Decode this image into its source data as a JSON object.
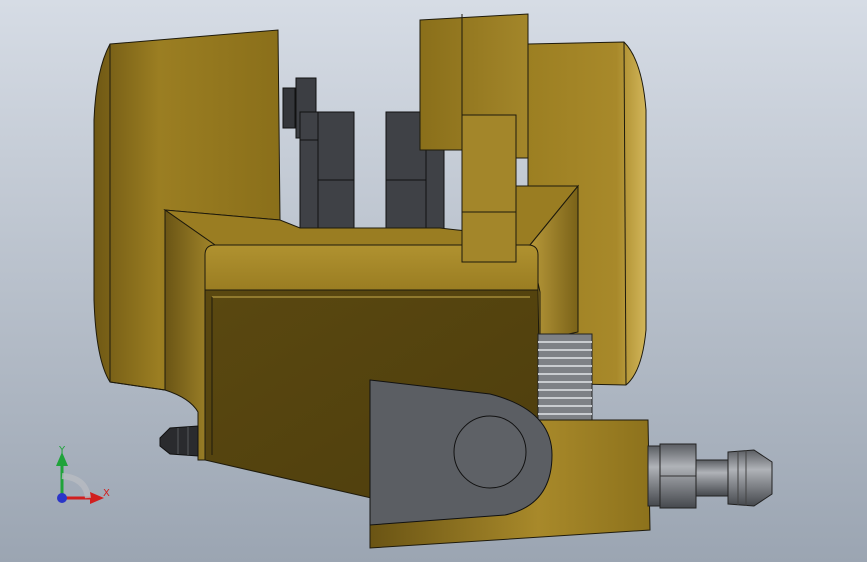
{
  "viewport": {
    "background_top": "#d5dbe4",
    "background_bottom": "#9aa4b1"
  },
  "model": {
    "body_color": "#a88a28",
    "body_dark": "#5d4a12",
    "body_light": "#d1b452",
    "pad_color": "#3f4146",
    "bracket_color": "#5a5d62",
    "fitting_color": "#8c8f94"
  },
  "triad": {
    "y_label": "Y",
    "x_label": "X",
    "y_color": "#1fa33a",
    "x_color": "#d11f1f",
    "z_color": "#2a35c8"
  }
}
